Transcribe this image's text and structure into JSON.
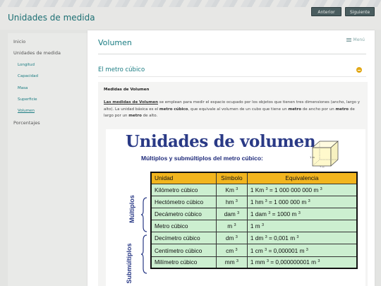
{
  "site": {
    "title": "Unidades de medida",
    "prev_label": "Anterior",
    "next_label": "Siguiente"
  },
  "sidebar": {
    "items": [
      {
        "label": "Inicio"
      },
      {
        "label": "Unidades de medida"
      },
      {
        "label": "Longitud"
      },
      {
        "label": "Capacidad"
      },
      {
        "label": "Masa"
      },
      {
        "label": "Superficie"
      },
      {
        "label": "Volumen",
        "active": true
      },
      {
        "label": "Porcentajes"
      }
    ]
  },
  "page": {
    "title": "Volumen",
    "menu_label": "Menú",
    "section_title": "El metro cúbico"
  },
  "content": {
    "subtitle": "Medidas de Volumen",
    "para": {
      "t1": "Las medidas de Volumen",
      "t2": " se emplean para medir el espacio ocupado por los objetos que tienen tres dimensiones (ancho, largo y alto). La unidad básica es el ",
      "t3": "metro cúbico",
      "t4": ", que equivale al volumen de un cubo que tiene un ",
      "t5": "metro",
      "t6": " de ancho por un ",
      "t7": "metro",
      "t8": " de largo por un ",
      "t9": "metro",
      "t10": " de alto."
    }
  },
  "figure": {
    "title": "Unidades de volumen",
    "subtitle": "Múltiplos y submúltiplos del metro cúbico:",
    "cube_dim": "1 m",
    "label_multiples": "Múltiplos",
    "label_submultiples": "Submúltiplos",
    "headers": [
      "Unidad",
      "Símbolo",
      "Equivalencia"
    ],
    "rows": [
      {
        "unit": "Kilómetro cúbico",
        "symbol": "Km",
        "eq_pre": "1 Km",
        "eq_post": " = 1 000 000 000 m"
      },
      {
        "unit": "Hectómetro cúbico",
        "symbol": "hm",
        "eq_pre": "1 hm",
        "eq_post": " = 1 000 000 m"
      },
      {
        "unit": "Decámetro cúbico",
        "symbol": "dam",
        "eq_pre": "1 dam",
        "eq_post": " = 1000 m"
      },
      {
        "unit": "Metro cúbico",
        "symbol": "m",
        "eq_pre": "1 m",
        "eq_post": ""
      },
      {
        "unit": "Decímetro cúbico",
        "symbol": "dm",
        "eq_pre": "1 dm",
        "eq_post": " = 0,001 m"
      },
      {
        "unit": "Centímetro cúbico",
        "symbol": "cm",
        "eq_pre": "1 cm",
        "eq_post": " = 0,000001 m"
      },
      {
        "unit": "Milímetro cúbico",
        "symbol": "mm",
        "eq_pre": "1 mm",
        "eq_post": " = 0,000000001 m"
      }
    ],
    "exp": "3"
  },
  "colors": {
    "accent": "#1a7c82",
    "header_fill": "#f2b51e",
    "cell_fill": "#ccefd0",
    "toggle": "#e2a816"
  }
}
